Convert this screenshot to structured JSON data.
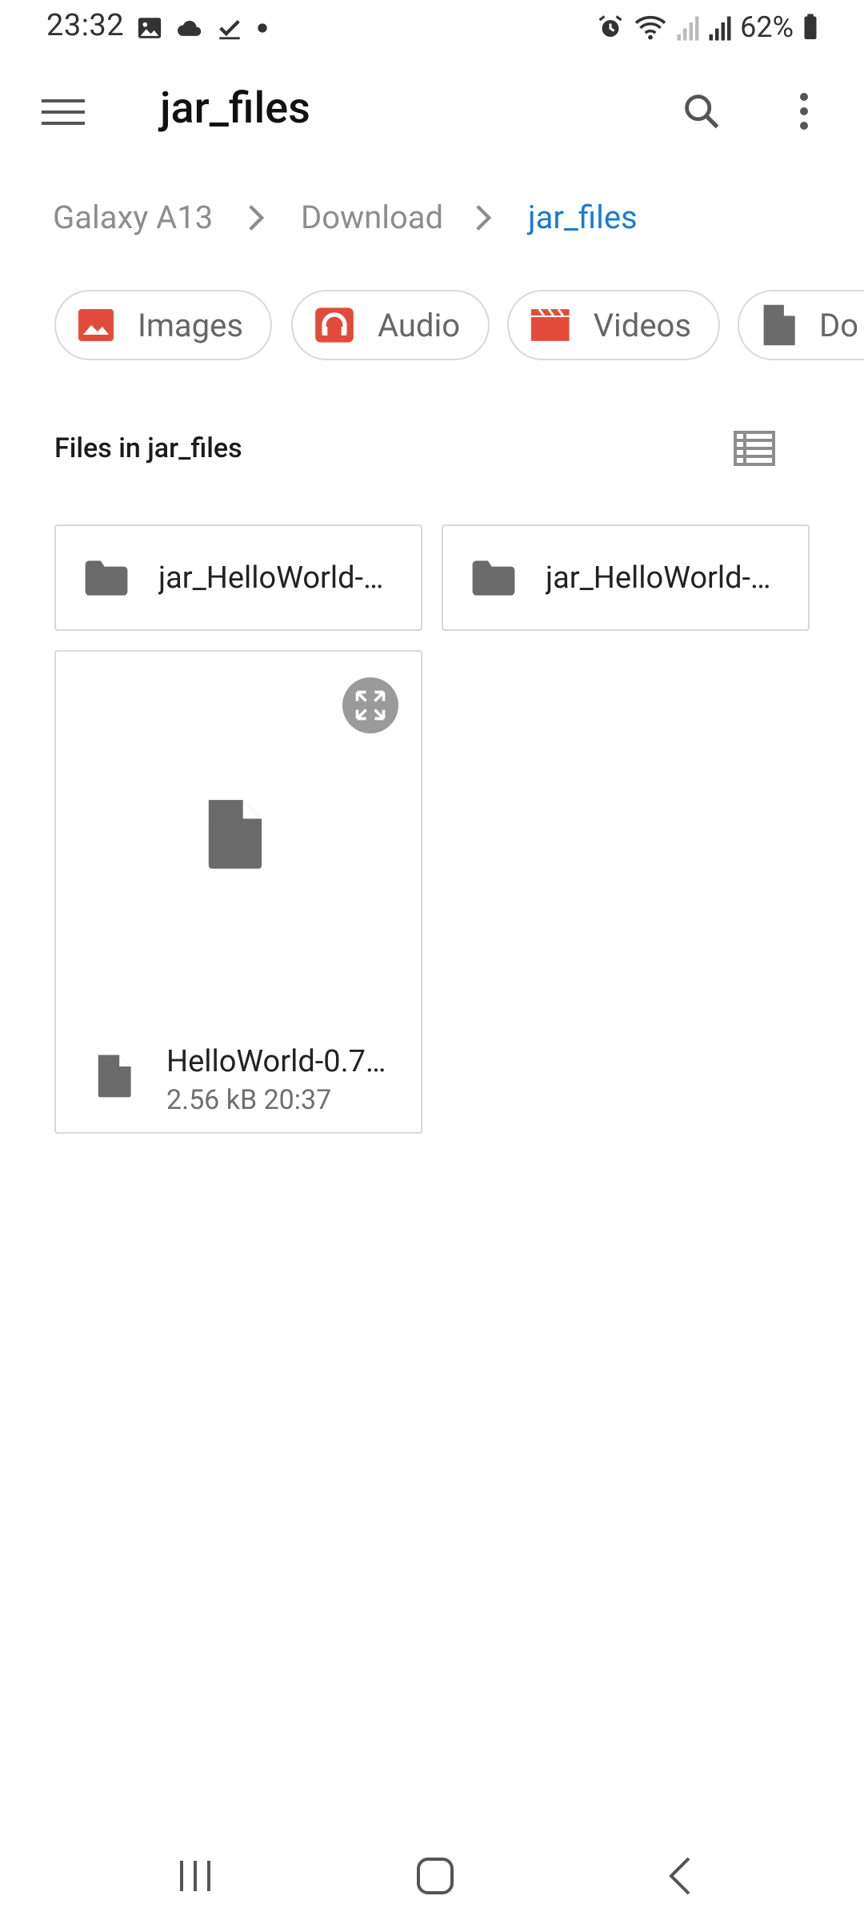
{
  "status_bar": {
    "time": "23:32",
    "battery_percent": "62%",
    "left_icons": [
      "image-icon",
      "cloud-icon",
      "check-icon",
      "dot-icon"
    ],
    "right_icons": [
      "alarm-icon",
      "wifi-icon",
      "signal-icon",
      "signal-icon",
      "battery-icon"
    ]
  },
  "app_bar": {
    "title": "jar_files"
  },
  "breadcrumb": {
    "items": [
      "Galaxy A13",
      "Download",
      "jar_files"
    ]
  },
  "categories": [
    {
      "label": "Images",
      "icon": "image-icon",
      "color": "#e24b3c"
    },
    {
      "label": "Audio",
      "icon": "headphones-icon",
      "color": "#e24b3c"
    },
    {
      "label": "Videos",
      "icon": "clapperboard-icon",
      "color": "#e24b3c"
    },
    {
      "label": "Do",
      "icon": "document-icon",
      "color": "#6b6b6b"
    }
  ],
  "files_section": {
    "title": "Files in jar_files"
  },
  "folders": [
    {
      "name": "jar_HelloWorld-…"
    },
    {
      "name": "jar_HelloWorld-…"
    }
  ],
  "file": {
    "name": "HelloWorld-0.7…",
    "size": "2.56 kB",
    "time": "20:37"
  },
  "colors": {
    "accent": "#1a7bd3",
    "icon_gray": "#6b6b6b",
    "category_red": "#e24b3c"
  }
}
